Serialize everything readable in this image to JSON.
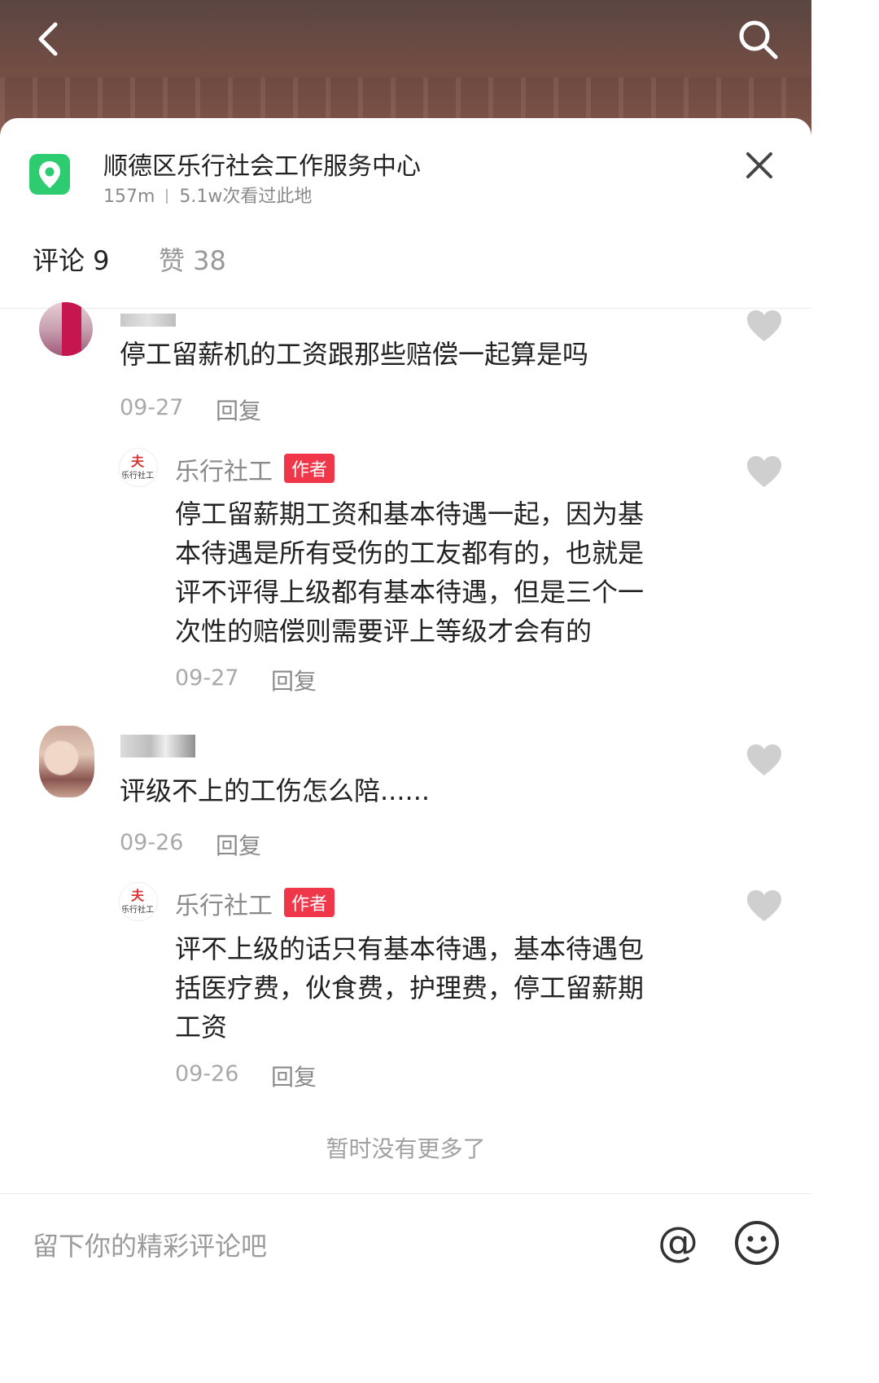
{
  "location": {
    "title": "顺德区乐行社会工作服务中心",
    "distance": "157m",
    "views": "5.1w次看过此地"
  },
  "tabs": {
    "comments": "评论 9",
    "likes": "赞 38"
  },
  "comments": [
    {
      "text": "停工留薪机的工资跟那些赔偿一起算是吗",
      "date": "09-27",
      "reply_label": "回复",
      "reply": {
        "author": "乐行社工",
        "badge": "作者",
        "lines": [
          "停工留薪期工资和基本待遇一起，因为基",
          "本待遇是所有受伤的工友都有的，也就是",
          "评不评得上级都有基本待遇，但是三个一",
          "次性的赔偿则需要评上等级才会有的"
        ],
        "date": "09-27",
        "reply_label": "回复"
      }
    },
    {
      "text": "评级不上的工伤怎么陪......",
      "date": "09-26",
      "reply_label": "回复",
      "reply": {
        "author": "乐行社工",
        "badge": "作者",
        "lines": [
          "评不上级的话只有基本待遇，基本待遇包",
          "括医疗费，伙食费，护理费，停工留薪期",
          "工资"
        ],
        "date": "09-26",
        "reply_label": "回复"
      }
    }
  ],
  "end_note": "暂时没有更多了",
  "input": {
    "placeholder": "留下你的精彩评论吧"
  },
  "avatar_logo": {
    "top": "夫",
    "bottom": "乐行社工"
  },
  "colors": {
    "location_green": "#2ecc71",
    "badge_red": "#f0374a",
    "heart_gray": "#cfcfcf"
  },
  "icons": [
    "back-icon",
    "search-icon",
    "location-pin-icon",
    "close-icon",
    "heart-icon",
    "at-icon",
    "emoji-icon"
  ]
}
